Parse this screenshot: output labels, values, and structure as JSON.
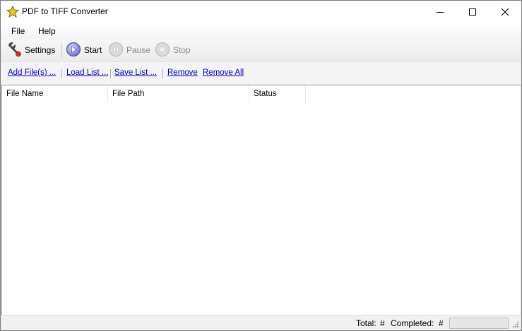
{
  "window": {
    "title": "PDF to TIFF Converter",
    "app_icon": "star-icon"
  },
  "menu": {
    "items": [
      "File",
      "Help"
    ]
  },
  "toolbar": {
    "settings": {
      "label": "Settings",
      "icon": "wrench-icon",
      "enabled": true
    },
    "start": {
      "label": "Start",
      "icon": "play-icon",
      "enabled": true
    },
    "pause": {
      "label": "Pause",
      "icon": "pause-icon",
      "enabled": false
    },
    "stop": {
      "label": "Stop",
      "icon": "stop-icon",
      "enabled": false
    }
  },
  "links": {
    "add_files": "Add File(s) ...",
    "load_list": "Load List ...",
    "save_list": "Save List ...",
    "remove": "Remove",
    "remove_all": "Remove All"
  },
  "file_list": {
    "columns": [
      "File Name",
      "File Path",
      "Status"
    ],
    "rows": []
  },
  "status": {
    "total_label": "Total:",
    "total_value": "#",
    "completed_label": "Completed:",
    "completed_value": "#",
    "progress": 0
  },
  "colors": {
    "link": "#0000cc",
    "disabled_text": "#8a8a8a",
    "accent": "#6c6cd6"
  }
}
